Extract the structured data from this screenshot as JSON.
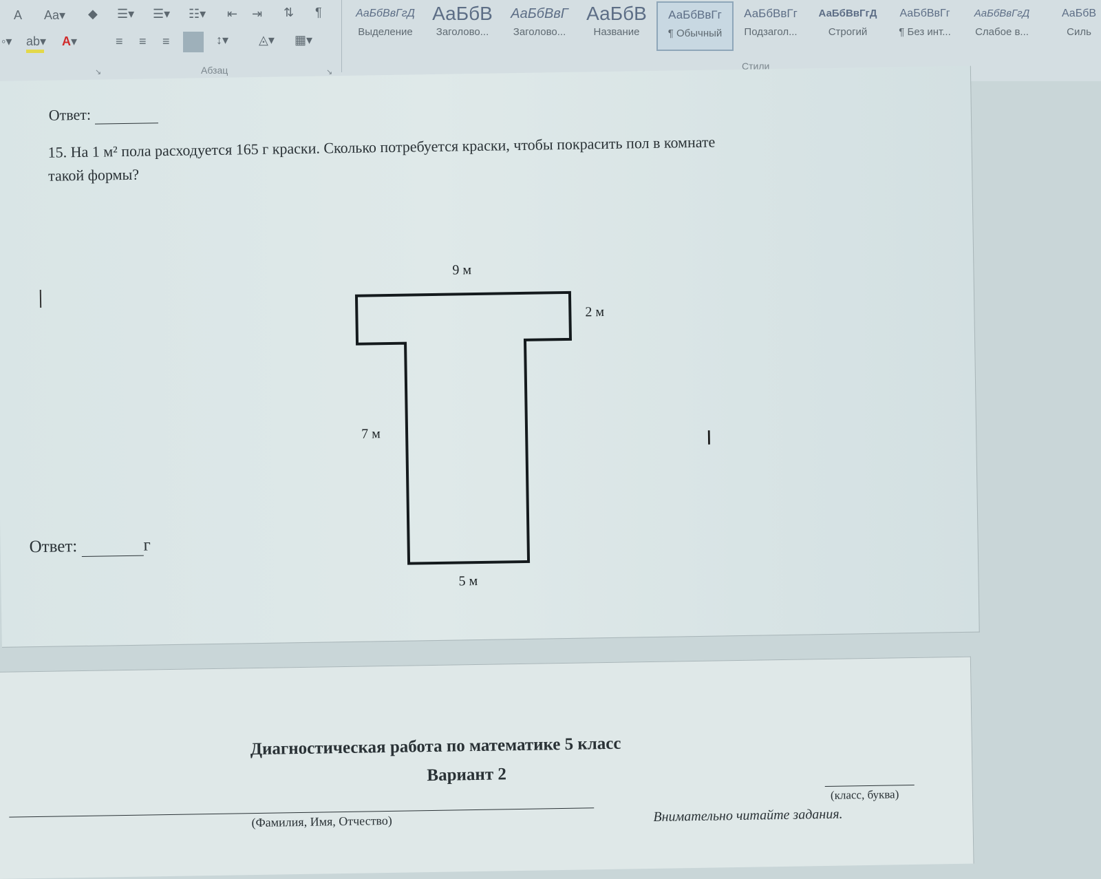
{
  "ribbon": {
    "paragraph_group_label": "Абзац",
    "styles_group_label": "Стили",
    "font_size_grow": "A",
    "change_case": "Aa",
    "highlight_color": "#e3d84a",
    "font_color": "#d02a2a",
    "styles": [
      {
        "preview": "АаБбВвГгД",
        "name": "Выделение"
      },
      {
        "preview": "АаБбВ",
        "name": "Заголово..."
      },
      {
        "preview": "АаБбВвГ",
        "name": "Заголово..."
      },
      {
        "preview": "АаБбВ",
        "name": "Название"
      },
      {
        "preview": "АаБбВвГг",
        "name": "¶ Обычный"
      },
      {
        "preview": "АаБбВвГг",
        "name": "Подзагол..."
      },
      {
        "preview": "АаБбВвГгД",
        "name": "Строгий"
      },
      {
        "preview": "АаБбВвГг",
        "name": "¶ Без инт..."
      },
      {
        "preview": "АаБбВвГгД",
        "name": "Слабое в..."
      },
      {
        "preview": "АаБбВ",
        "name": "Силь"
      }
    ]
  },
  "document": {
    "prev_answer_label": "Ответ:",
    "question_number": "15.",
    "question_line1": "На 1 м² пола расходуется 165 г краски. Сколько потребуется краски, чтобы покрасить пол в комнате",
    "question_line2": "такой формы?",
    "dimensions": {
      "top_width": "9 м",
      "top_height": "2 м",
      "stem_height": "7 м",
      "stem_width": "5 м"
    },
    "answer_label": "Ответ:",
    "answer_unit": "г",
    "next_page": {
      "title": "Диагностическая работа по математике 5 класс",
      "variant": "Вариант 2",
      "class_caption": "(класс, буква)",
      "name_caption": "(Фамилия, Имя, Отчество)",
      "instruction": "Внимательно читайте задания."
    }
  }
}
